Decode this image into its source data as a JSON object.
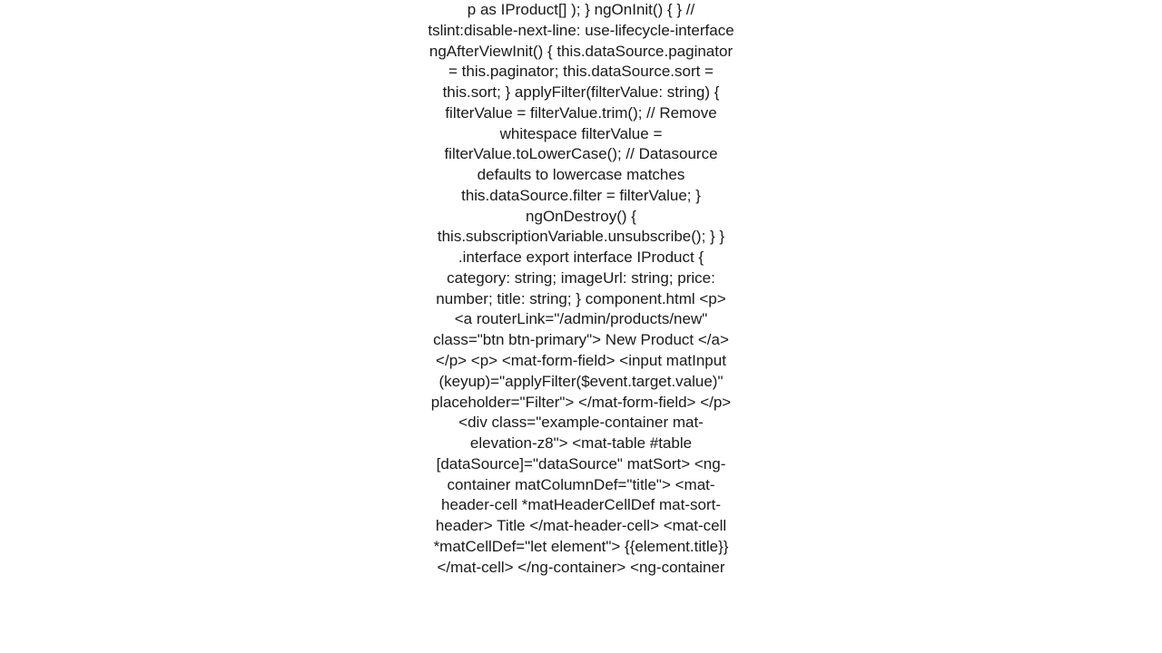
{
  "document": {
    "body": "p as IProduct[] );   }    ngOnInit() {   }     // tslint:disable-next-line: use-lifecycle-interface   ngAfterViewInit()   {     this.dataSource.paginator = this.paginator;     this.dataSource.sort = this.sort;   }    applyFilter(filterValue: string) {     filterValue = filterValue.trim(); // Remove whitespace     filterValue = filterValue.toLowerCase(); // Datasource defaults to lowercase matches     this.dataSource.filter = filterValue;   }    ngOnDestroy() {     this.subscriptionVariable.unsubscribe();   }    }  .interface export interface IProduct {     category: string;     imageUrl: string;     price: number;     title: string; }  component.html <p>     <a routerLink=\"/admin/products/new\" class=\"btn btn-primary\">     New Product   </a> </p> <p>    <mat-form-field>     <input matInput (keyup)=\"applyFilter($event.target.value)\" placeholder=\"Filter\">   </mat-form-field> </p>      <div class=\"example-container mat-elevation-z8\">    <mat-table #table [dataSource]=\"dataSource\" matSort>      <ng-container matColumnDef=\"title\">       <mat-header-cell *matHeaderCellDef mat-sort-header> Title </mat-header-cell>       <mat-cell *matCellDef=\"let element\"> {{element.title}} </mat-cell>     </ng-container>      <ng-container"
  }
}
